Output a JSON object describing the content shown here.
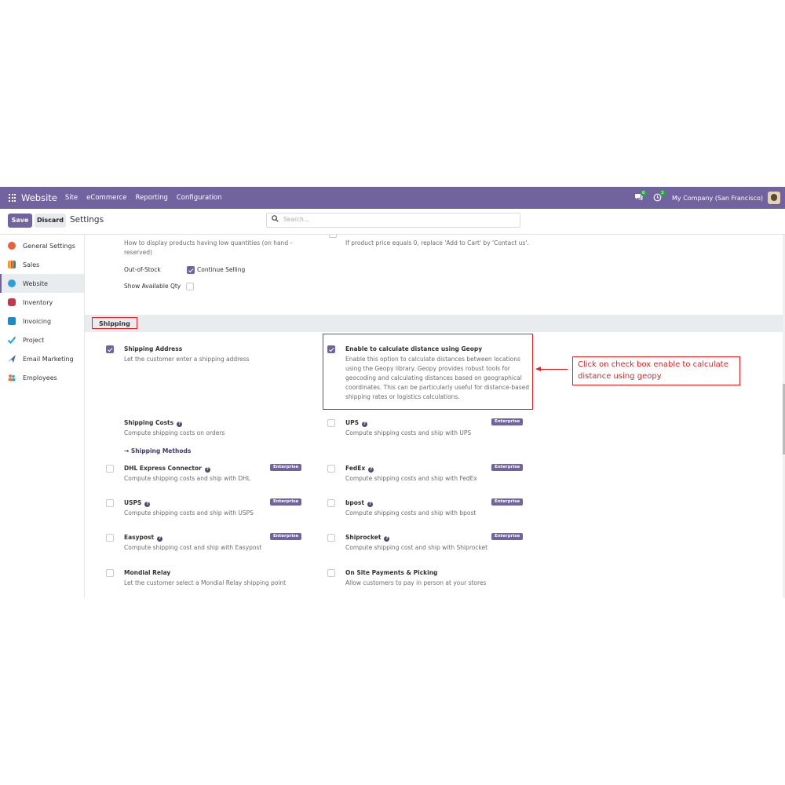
{
  "navbar": {
    "brand": "Website",
    "menu": [
      "Site",
      "eCommerce",
      "Reporting",
      "Configuration"
    ],
    "messages_count": "6",
    "activities_count": "3",
    "company": "My Company (San Francisco)"
  },
  "control": {
    "save_label": "Save",
    "discard_label": "Discard",
    "title": "Settings",
    "search_placeholder": "Search..."
  },
  "sidebar": {
    "items": [
      {
        "label": "General Settings",
        "color": "#e8613b"
      },
      {
        "label": "Sales",
        "color": "#f0a020"
      },
      {
        "label": "Website",
        "color": "#2c9fd8"
      },
      {
        "label": "Inventory",
        "color": "#c2384e"
      },
      {
        "label": "Invoicing",
        "color": "#1f8acb"
      },
      {
        "label": "Project",
        "color": "#2ba5d9"
      },
      {
        "label": "Email Marketing",
        "color": "#3d65c4"
      },
      {
        "label": "Employees",
        "color": "#e07b39"
      }
    ]
  },
  "top": {
    "left_desc": "How to display products having low quantities (on hand -",
    "left_desc2": "reserved)",
    "right_desc": "If product price equals 0, replace 'Add to Cart' by 'Contact us'.",
    "out_of_stock_label": "Out-of-Stock",
    "continue_selling": "Continue Selling",
    "show_available_qty": "Show Available Qty"
  },
  "section": {
    "title": "Shipping"
  },
  "settings": {
    "shipping_address": {
      "title": "Shipping Address",
      "desc": "Let the customer enter a shipping address"
    },
    "geopy": {
      "title": "Enable to calculate distance using Geopy",
      "desc": [
        "Enable this option to calculate distances between locations",
        "using the Geopy library. Geopy provides robust tools for",
        "geocoding and calculating distances based on geographical",
        "coordinates. This can be particularly useful for distance-based",
        "shipping rates or logistics calculations."
      ]
    },
    "shipping_costs": {
      "title": "Shipping Costs",
      "desc": "Compute shipping costs on orders",
      "link": "Shipping Methods"
    },
    "ups": {
      "title": "UPS",
      "desc": "Compute shipping costs and ship with UPS"
    },
    "dhl": {
      "title": "DHL Express Connector",
      "desc": "Compute shipping costs and ship with DHL"
    },
    "fedex": {
      "title": "FedEx",
      "desc": "Compute shipping costs and ship with FedEx"
    },
    "usps": {
      "title": "USPS",
      "desc": "Compute shipping costs and ship with USPS"
    },
    "bpost": {
      "title": "bpost",
      "desc": "Compute shipping costs and ship with bpost"
    },
    "easypost": {
      "title": "Easypost",
      "desc": "Compute shipping cost and ship with Easypost"
    },
    "shiprocket": {
      "title": "Shiprocket",
      "desc": "Compute shipping cost and ship with Shiprocket"
    },
    "mondial": {
      "title": "Mondial Relay",
      "desc": "Let the customer select a Mondial Relay shipping point"
    },
    "onsite": {
      "title": "On Site Payments & Picking",
      "desc": "Allow customers to pay in person at your stores"
    },
    "enterprise_label": "Enterprise"
  },
  "annotation": {
    "text": "Click on check box enable to calculate distance using geopy"
  },
  "colors": {
    "brand": "#71639e",
    "annotation": "#e22424",
    "badge": "#28a745"
  }
}
